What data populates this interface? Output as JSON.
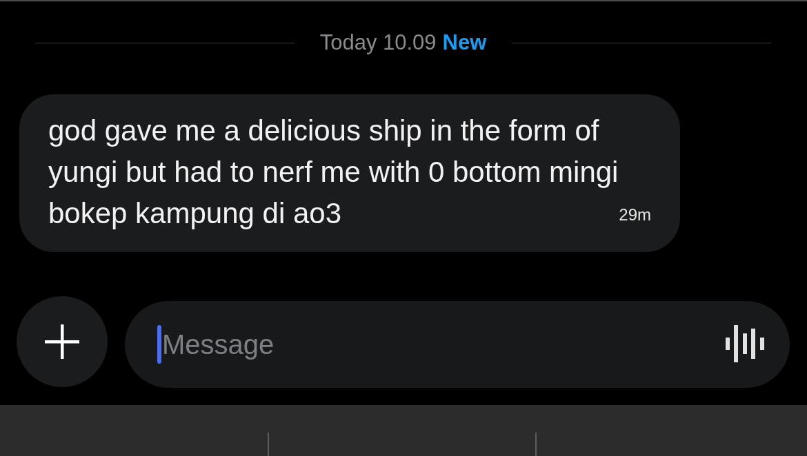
{
  "divider": {
    "date": "Today 10.09",
    "new_label": "New"
  },
  "messages": [
    {
      "text": "god gave me a delicious ship in the form of\nyungi but had to nerf me with 0 bottom mingi\nbokep kampung di ao3",
      "time": "29m"
    }
  ],
  "composer": {
    "placeholder": "Message",
    "focused": true
  }
}
